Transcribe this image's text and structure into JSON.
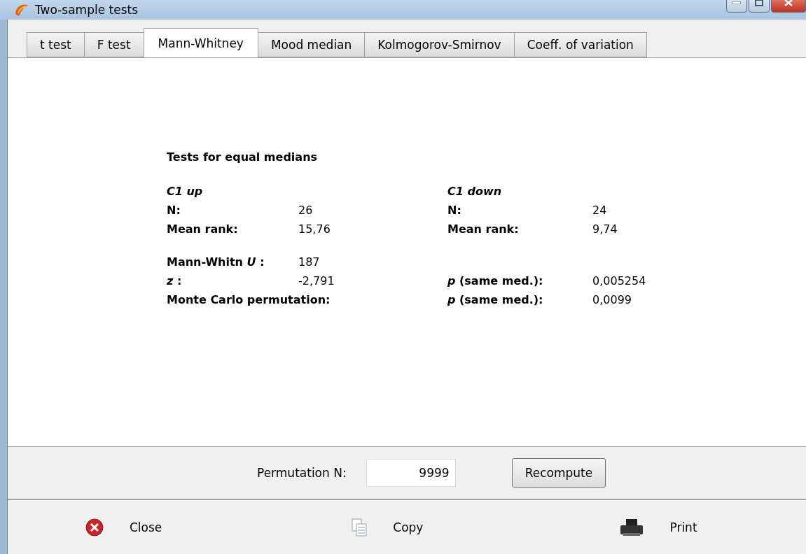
{
  "window": {
    "title": "Two-sample tests"
  },
  "tabs": [
    {
      "label": "t test",
      "selected": false
    },
    {
      "label": "F test",
      "selected": false
    },
    {
      "label": "Mann-Whitney",
      "selected": true
    },
    {
      "label": "Mood median",
      "selected": false
    },
    {
      "label": "Kolmogorov-Smirnov",
      "selected": false
    },
    {
      "label": "Coeff. of variation",
      "selected": false
    }
  ],
  "report": {
    "title": "Tests for equal medians",
    "sections": [
      [
        {
          "kind": "heading",
          "left_label": "C1 up",
          "right_label": "C1 down"
        },
        {
          "kind": "row",
          "left_label": "N:",
          "left_value": "26",
          "right_label": "N:",
          "right_value": "24"
        },
        {
          "kind": "row",
          "left_label": "Mean rank:",
          "left_value": "15,76",
          "right_label": "Mean rank:",
          "right_value": "9,74"
        }
      ],
      [
        {
          "kind": "row",
          "left_label": "Mann-Whitn *U* :",
          "left_value": "187"
        },
        {
          "kind": "row",
          "left_label": "*z* :",
          "left_value": "-2,791",
          "right_label": "*p* (same med.):",
          "right_value": "0,005254"
        },
        {
          "kind": "row",
          "left_label": "Monte Carlo permutation:",
          "right_label": "*p* (same med.):",
          "right_value": "0,0099"
        }
      ]
    ]
  },
  "permutation": {
    "label": "Permutation N:",
    "value": "9999",
    "button": "Recompute"
  },
  "actions": [
    {
      "kind": "close",
      "label": "Close"
    },
    {
      "kind": "copy",
      "label": "Copy"
    },
    {
      "kind": "print",
      "label": "Print"
    }
  ]
}
